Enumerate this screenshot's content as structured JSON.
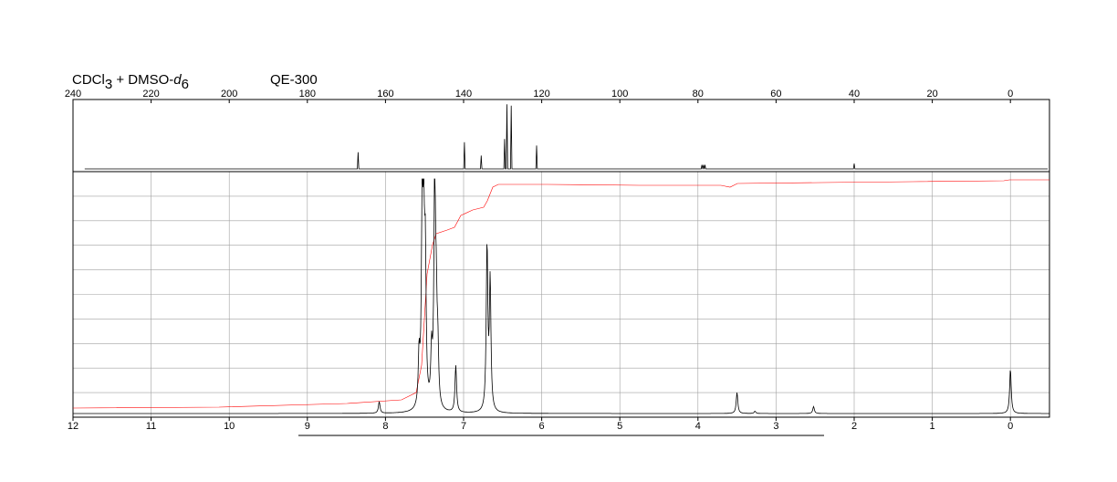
{
  "header": {
    "solvent_main": "CDCl",
    "solvent_sub1": "3",
    "solvent_mid": " + DMSO-",
    "solvent_italic": "d",
    "solvent_sub2": "6",
    "instrument": "QE-300"
  },
  "chart_data": [
    {
      "type": "line",
      "nucleus": "13C",
      "x_reversed": true,
      "xlim": [
        240,
        -10
      ],
      "x_ticks": [
        240,
        220,
        200,
        180,
        160,
        140,
        120,
        100,
        80,
        60,
        40,
        20,
        0
      ],
      "peaks": [
        {
          "ppm": 167.0,
          "height": 0.25
        },
        {
          "ppm": 139.8,
          "height": 0.4
        },
        {
          "ppm": 135.5,
          "height": 0.2
        },
        {
          "ppm": 129.5,
          "height": 0.45
        },
        {
          "ppm": 128.9,
          "height": 0.97
        },
        {
          "ppm": 127.8,
          "height": 0.95
        },
        {
          "ppm": 121.3,
          "height": 0.35
        },
        {
          "ppm": 79.0,
          "height": 0.06
        },
        {
          "ppm": 78.6,
          "height": 0.06
        },
        {
          "ppm": 78.2,
          "height": 0.06
        },
        {
          "ppm": 40.0,
          "height": 0.08
        }
      ]
    },
    {
      "type": "line",
      "nucleus": "1H",
      "x_reversed": true,
      "xlim": [
        12,
        -0.5
      ],
      "x_ticks": [
        12,
        11,
        10,
        9,
        8,
        7,
        6,
        5,
        4,
        3,
        2,
        1,
        0
      ],
      "grid": true,
      "horizontal_gridlines": 10,
      "peaks": [
        {
          "ppm": 8.08,
          "height": 0.05
        },
        {
          "ppm": 7.57,
          "height": 0.21
        },
        {
          "ppm": 7.53,
          "height": 0.82
        },
        {
          "ppm": 7.51,
          "height": 0.64
        },
        {
          "ppm": 7.49,
          "height": 0.58
        },
        {
          "ppm": 7.41,
          "height": 0.22
        },
        {
          "ppm": 7.37,
          "height": 0.98
        },
        {
          "ppm": 7.35,
          "height": 0.36
        },
        {
          "ppm": 7.33,
          "height": 0.22
        },
        {
          "ppm": 7.1,
          "height": 0.2
        },
        {
          "ppm": 6.7,
          "height": 0.7
        },
        {
          "ppm": 6.66,
          "height": 0.55
        },
        {
          "ppm": 3.5,
          "height": 0.09
        },
        {
          "ppm": 3.27,
          "height": 0.01
        },
        {
          "ppm": 2.52,
          "height": 0.03
        },
        {
          "ppm": 0.0,
          "height": 0.19
        }
      ]
    }
  ],
  "colors": {
    "spectrum": "#000000",
    "integral": "#ff0000",
    "grid": "#a0a0a0",
    "frame": "#000000"
  }
}
